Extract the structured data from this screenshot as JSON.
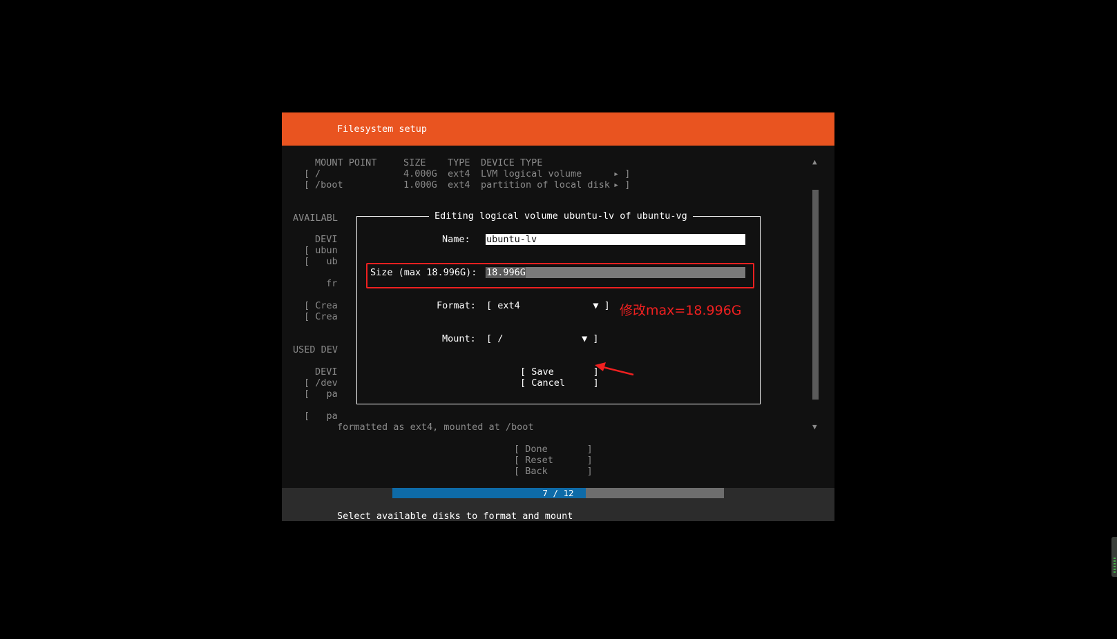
{
  "header": {
    "title": "Filesystem setup"
  },
  "summary": {
    "columns": [
      "MOUNT POINT",
      "SIZE",
      "TYPE",
      "DEVICE TYPE"
    ],
    "rows": [
      {
        "open": "[",
        "mount": "/",
        "size": "4.000G",
        "type": "ext4",
        "device": "LVM logical volume",
        "arrow": "▸ ]"
      },
      {
        "open": "[",
        "mount": "/boot",
        "size": "1.000G",
        "type": "ext4",
        "device": "partition of local disk",
        "arrow": "▸ ]"
      }
    ]
  },
  "available": {
    "heading": "AVAILABL",
    "lines": [
      "DEVI",
      "[ ubun",
      "[   ub",
      "fr",
      "[ Crea",
      "[ Crea"
    ]
  },
  "used": {
    "heading": "USED DEV",
    "lines": [
      "DEVI",
      "[ /dev",
      "[   pa",
      "[   pa"
    ],
    "note": "formatted as ext4, mounted at /boot"
  },
  "actions": {
    "done": "[ Done       ]",
    "reset": "[ Reset      ]",
    "back": "[ Back       ]"
  },
  "dialog": {
    "title": "Editing logical volume ubuntu-lv of ubuntu-vg",
    "name_label": "Name:",
    "name_value": "ubuntu-lv",
    "size_label": "Size (max 18.996G):",
    "size_value": "18.996G",
    "format_label": "Format:",
    "format_value": "[ ext4             ▼ ]",
    "mount_label": "Mount:",
    "mount_value": "[ /              ▼ ]",
    "save": "[ Save       ]",
    "cancel": "[ Cancel     ]"
  },
  "annotation": {
    "text": "修改max=18.996G",
    "color": "#f02020"
  },
  "footer": {
    "progress_text": "7 / 12",
    "progress_current": 7,
    "progress_total": 12,
    "hint": "Select available disks to format and mount"
  },
  "scroll": {
    "up": "▲",
    "down": "▼"
  },
  "colors": {
    "header": "#e95420",
    "progress": "#0e6ba8",
    "background": "#111111"
  }
}
